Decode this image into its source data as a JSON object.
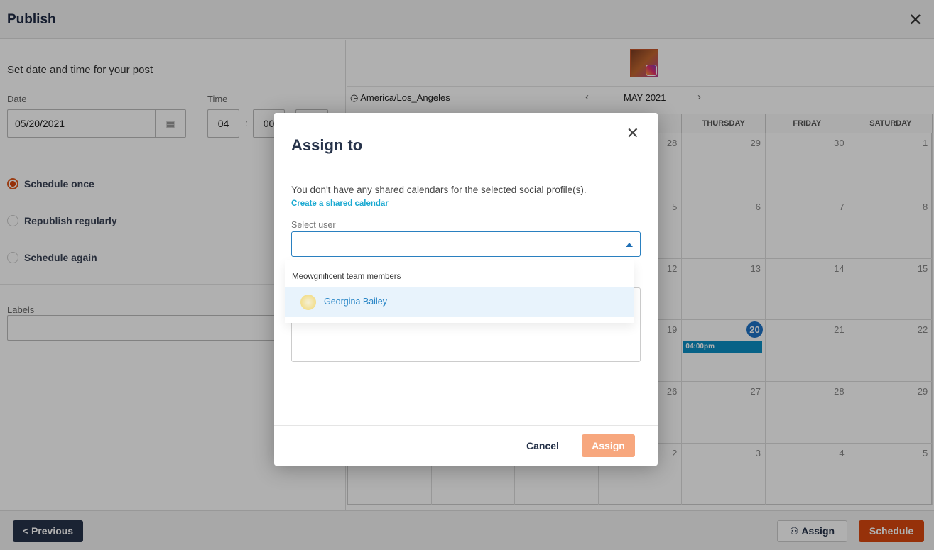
{
  "header": {
    "title": "Publish",
    "close_icon": "close-icon"
  },
  "left": {
    "heading": "Set date and time for your post",
    "date_label": "Date",
    "date_value": "05/20/2021",
    "time_label": "Time",
    "hour": "04",
    "minute": "00",
    "separator": ":",
    "options": [
      {
        "label": "Schedule once",
        "selected": true
      },
      {
        "label": "Republish regularly",
        "selected": false
      },
      {
        "label": "Schedule again",
        "selected": false
      }
    ],
    "labels_label": "Labels"
  },
  "calendar": {
    "timezone": "America/Los_Angeles",
    "month": "MAY 2021",
    "days": [
      "",
      "",
      "",
      "AY",
      "THURSDAY",
      "FRIDAY",
      "SATURDAY"
    ],
    "weeks": [
      [
        "",
        "",
        "",
        "28",
        "29",
        "30",
        "1"
      ],
      [
        "",
        "",
        "",
        "5",
        "6",
        "7",
        "8"
      ],
      [
        "",
        "",
        "",
        "12",
        "13",
        "14",
        "15"
      ],
      [
        "",
        "",
        "",
        "19",
        "20",
        "21",
        "22"
      ],
      [
        "",
        "",
        "",
        "26",
        "27",
        "28",
        "29"
      ],
      [
        "",
        "",
        "",
        "2",
        "3",
        "4",
        "5"
      ]
    ],
    "today": "20",
    "event": "04:00pm",
    "event_color": "#0b8fc4"
  },
  "footer": {
    "previous": "< Previous",
    "assign": "Assign",
    "schedule": "Schedule"
  },
  "modal": {
    "title": "Assign to",
    "message": "You don't have any shared calendars for the selected social profile(s).",
    "link": "Create a shared calendar",
    "select_label": "Select user",
    "select_value": "",
    "dropdown": {
      "group": "Meowgnificent team members",
      "options": [
        "Georgina Bailey"
      ]
    },
    "cancel": "Cancel",
    "assign": "Assign"
  },
  "colors": {
    "accent": "#d9470f",
    "assign_disabled": "#f7a77e",
    "link": "#1aa9d1",
    "navy": "#27334a"
  }
}
